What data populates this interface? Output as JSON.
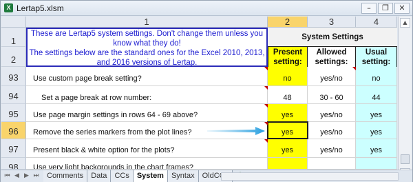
{
  "window": {
    "title": "Lertap5.xlsm",
    "buttons": {
      "minimize": "–",
      "restore": "❐",
      "close": "✕"
    }
  },
  "columns": [
    "1",
    "2",
    "3",
    "4"
  ],
  "header": {
    "note_lines": [
      "These are Lertap5 system settings. Don't change them unless you",
      "know what they do!",
      "The settings below are the standard ones for the Excel 2010, 2013,",
      "and 2016 versions of Lertap."
    ],
    "row_numbers": [
      "1",
      "2"
    ],
    "system_title": "System Settings",
    "present": [
      "Present",
      "setting:"
    ],
    "allowed": [
      "Allowed",
      "settings:"
    ],
    "usual": [
      "Usual",
      "setting:"
    ]
  },
  "rows": [
    {
      "num": "93",
      "label": "Use custom page break setting?",
      "present": "no",
      "allowed": "yes/no",
      "usual": "no"
    },
    {
      "num": "94",
      "label": "Set a page break at row number:",
      "present": "48",
      "allowed": "30 - 60",
      "usual": "44"
    },
    {
      "num": "95",
      "label": "Use page margin settings in rows 64 - 69 above?",
      "present": "yes",
      "allowed": "yes/no",
      "usual": "yes"
    },
    {
      "num": "96",
      "label": "Remove the series markers from the plot lines?",
      "present": "yes",
      "allowed": "yes/no",
      "usual": "yes"
    },
    {
      "num": "97",
      "label": "Present black & white option for the plots?",
      "present": "yes",
      "allowed": "yes/no",
      "usual": "yes"
    },
    {
      "num": "98",
      "label": "Use very light backgrounds in the chart frames?",
      "present": "",
      "allowed": "",
      "usual": ""
    }
  ],
  "sheet_tabs": [
    "Comments",
    "Data",
    "CCs",
    "System",
    "Syntax",
    "OldCCs"
  ],
  "active_tab": "System",
  "colors": {
    "present": "#ffff00",
    "usual": "#ccffff",
    "note_text": "#1a1ad0",
    "selected_header": "#f9d46b",
    "arrow": "#2aa0e0"
  }
}
